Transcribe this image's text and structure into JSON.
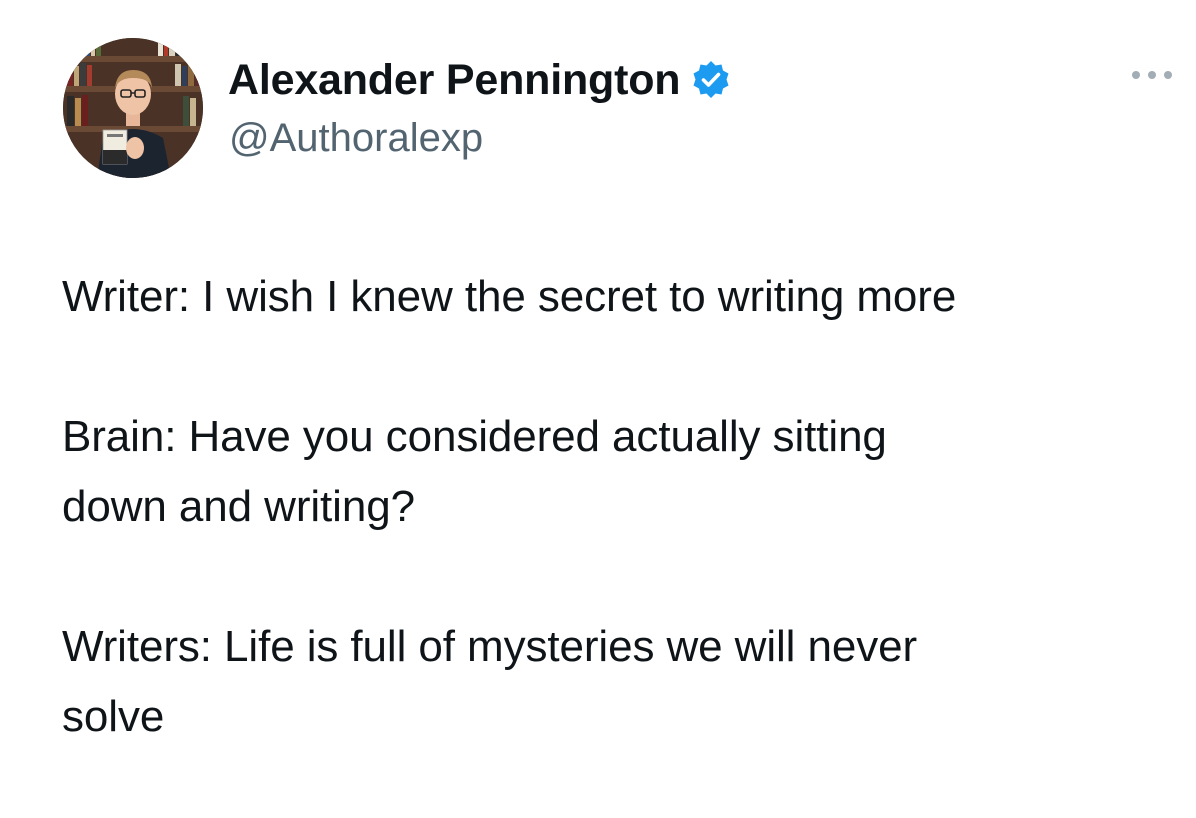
{
  "tweet": {
    "author": {
      "display_name": "Alexander Pennington",
      "handle": "@Authoralexp",
      "verified": true,
      "avatar_icon": "profile-photo",
      "verified_icon": "verified-badge-icon",
      "verified_color": "#1d9bf0"
    },
    "more_icon": "more-options-icon",
    "paragraphs": [
      "Writer: I wish I knew the secret to writing more",
      "Brain: Have you considered actually sitting\ndown and writing?",
      "Writers: Life is full of mysteries we will never\nsolve"
    ]
  },
  "colors": {
    "text": "#0f1419",
    "secondary_text": "#536471",
    "accent": "#1d9bf0",
    "background": "#ffffff"
  }
}
